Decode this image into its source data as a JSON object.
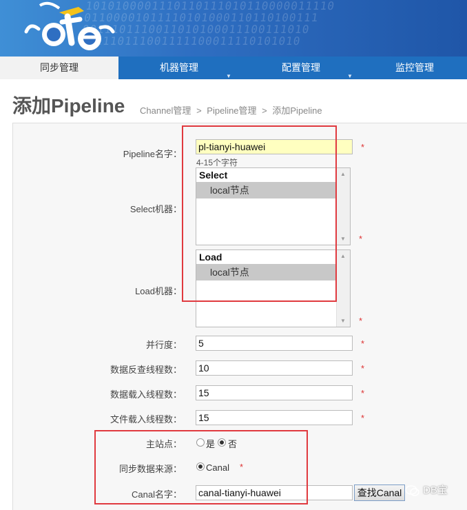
{
  "banner": {
    "bits": "1010100001110110111010110000011110\n01100001011110101000110110100111\n0011101110011010100011100111010\n011110111001111100011110101010"
  },
  "nav": {
    "items": [
      {
        "label": "同步管理",
        "active": true
      },
      {
        "label": "机器管理",
        "active": false
      },
      {
        "label": "配置管理",
        "active": false
      },
      {
        "label": "监控管理",
        "active": false
      }
    ]
  },
  "page": {
    "title": "添加Pipeline",
    "breadcrumb": [
      "Channel管理",
      ">",
      "Pipeline管理",
      ">",
      "添加Pipeline"
    ]
  },
  "form": {
    "pipeline_name_label": "Pipeline名字：",
    "pipeline_name_value": "pl-tianyi-huawei",
    "pipeline_name_hint": "4-15个字符",
    "select_label": "Select机器：",
    "select_group": "Select",
    "select_option": "local节点",
    "load_label": "Load机器：",
    "load_group": "Load",
    "load_option": "local节点",
    "parallelism_label": "并行度：",
    "parallelism_value": "5",
    "extract_threads_label": "数据反查线程数：",
    "extract_threads_value": "10",
    "load_threads_label": "数据载入线程数：",
    "load_threads_value": "15",
    "file_threads_label": "文件载入线程数：",
    "file_threads_value": "15",
    "main_site_label": "主站点：",
    "main_site_yes": "是",
    "main_site_no": "否",
    "sync_source_label": "同步数据来源：",
    "sync_source_option": "Canal",
    "canal_name_label": "Canal名字：",
    "canal_name_value": "canal-tianyi-huawei",
    "find_canal_button": "查找Canal",
    "required_mark": "*"
  },
  "watermark": {
    "text": "DB宝"
  }
}
